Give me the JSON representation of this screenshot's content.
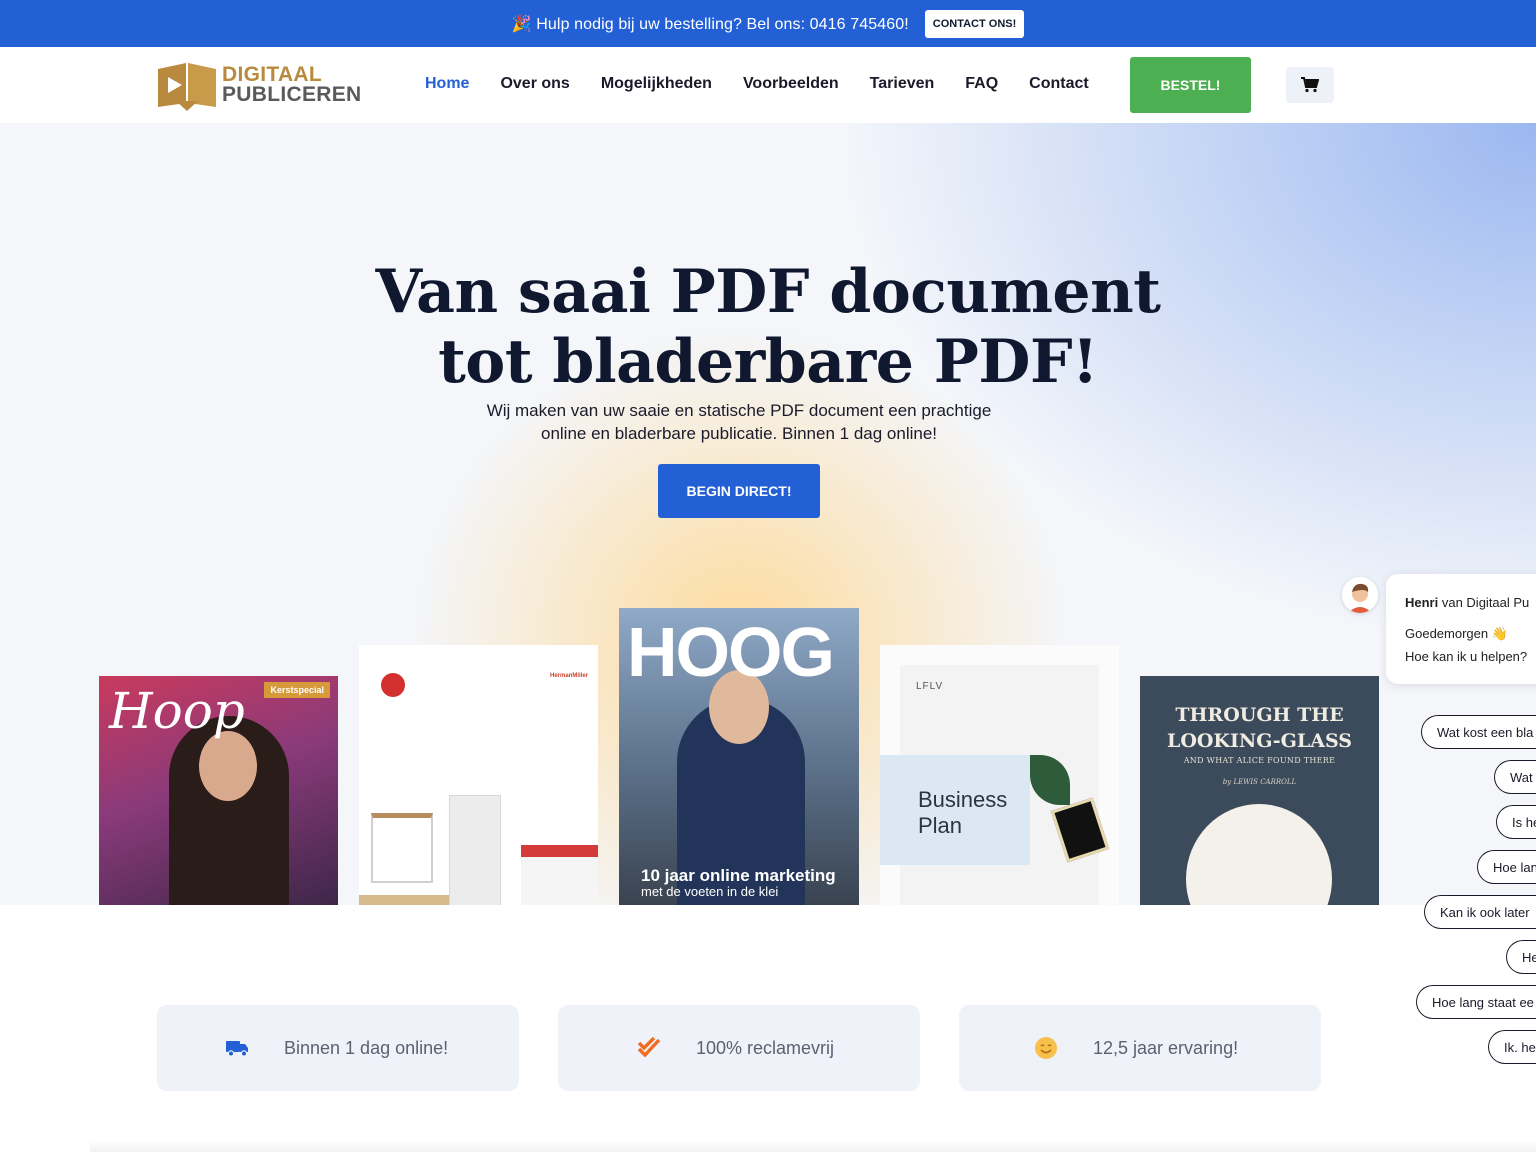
{
  "topbar": {
    "emoji": "🎉",
    "text": "Hulp nodig bij uw bestelling? Bel ons: 0416 745460!",
    "contact_label": "CONTACT ONS!"
  },
  "logo": {
    "line1": "DIGITAAL",
    "line2": "PUBLICEREN"
  },
  "nav": {
    "items": [
      "Home",
      "Over ons",
      "Mogelijkheden",
      "Voorbeelden",
      "Tarieven",
      "FAQ",
      "Contact"
    ],
    "order_label": "BESTEL!",
    "cart_icon": "cart-icon"
  },
  "hero": {
    "title_line1": "Van saai PDF document",
    "title_line2": "tot bladerbare PDF!",
    "subtitle_line1": "Wij maken van uw saaie en statische PDF document een prachtige",
    "subtitle_line2": "online en bladerbare publicatie. Binnen 1 dag online!",
    "cta_label": "BEGIN DIRECT!"
  },
  "magazines": {
    "hoop": {
      "title": "Hoop",
      "badge": "Kerstspecial"
    },
    "hermanmiller": {
      "brand": "HermanMiller"
    },
    "hoog": {
      "title": "HOOG",
      "caption_line1": "10 jaar online marketing",
      "caption_line2": "met de voeten in de klei"
    },
    "business": {
      "brand": "LFLV",
      "title_line1": "Business",
      "title_line2": "Plan"
    },
    "alice": {
      "title_line1": "THROUGH THE",
      "title_line2": "LOOKING-GLASS",
      "subtitle": "AND WHAT ALICE FOUND THERE",
      "author": "by LEWIS CARROLL"
    }
  },
  "features": [
    {
      "icon": "truck-icon",
      "text": "Binnen 1 dag online!"
    },
    {
      "icon": "double-check-icon",
      "text": "100% reclamevrij"
    },
    {
      "icon": "smiley-icon",
      "text": "12,5 jaar ervaring!"
    }
  ],
  "chat": {
    "sender_name": "Henri",
    "sender_rest": " van Digitaal Pu",
    "greeting": "Goedemorgen 👋",
    "question": "Hoe kan ik u helpen?",
    "quick_replies": [
      "Wat kost een bla",
      "Wat",
      "Is he",
      "Hoe lan",
      "Kan ik ook later",
      "He",
      "Hoe lang staat ee",
      "Ik. he"
    ]
  },
  "colors": {
    "brand_blue": "#2360d6",
    "order_green": "#4cb052",
    "logo_gold": "#b98a3d"
  }
}
